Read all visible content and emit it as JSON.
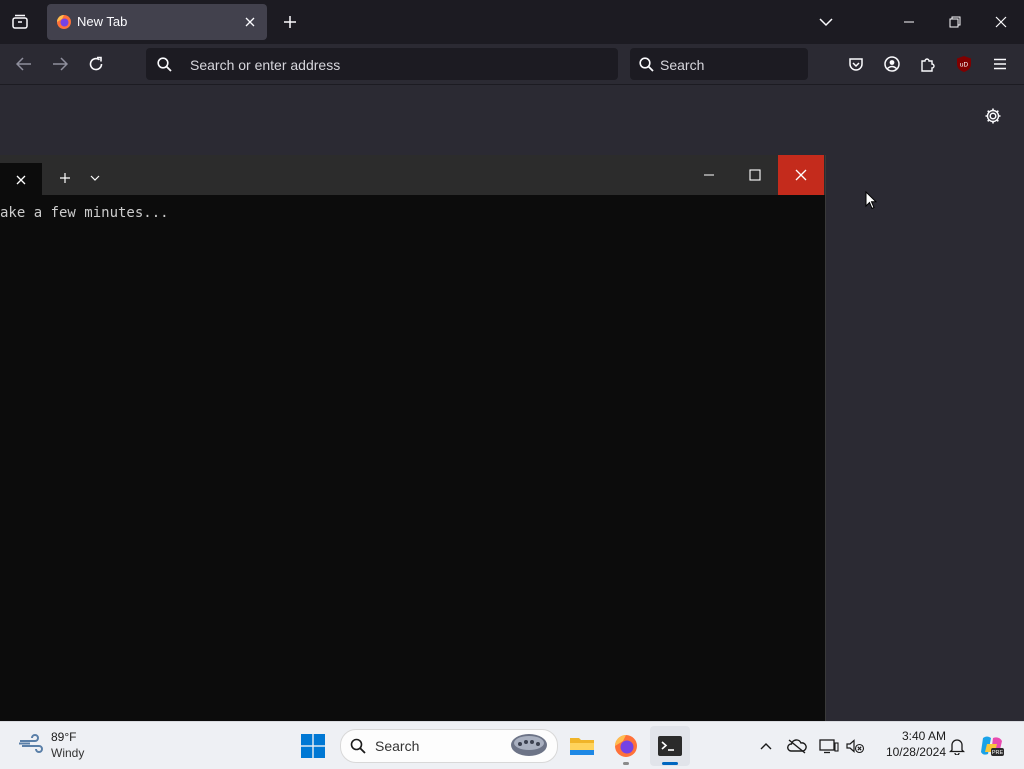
{
  "browser": {
    "tab": {
      "title": "New Tab"
    },
    "urlbar": {
      "placeholder": "Search or enter address"
    },
    "searchbar": {
      "placeholder": "Search"
    },
    "extension_badge": "uD",
    "accent": "#42414d"
  },
  "terminal": {
    "output_line": "ake a few minutes...",
    "close_color": "#c42b1c"
  },
  "taskbar": {
    "weather": {
      "temp": "89°F",
      "condition": "Windy"
    },
    "search": {
      "placeholder": "Search"
    },
    "clock": {
      "time": "3:40 AM",
      "date": "10/28/2024"
    }
  }
}
